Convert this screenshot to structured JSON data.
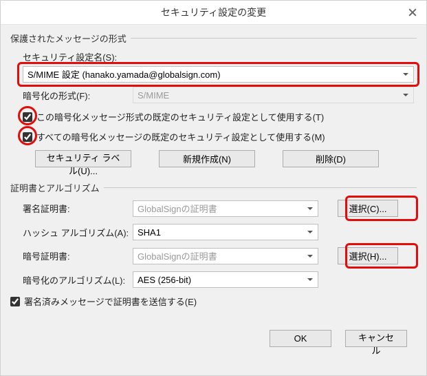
{
  "title": "セキュリティ設定の変更",
  "group1_title": "保護されたメッセージの形式",
  "security_name_label": "セキュリティ設定名(S):",
  "security_name_value": "S/MIME 設定 (hanako.yamada@globalsign.com)",
  "enc_format_label": "暗号化の形式(F):",
  "enc_format_value": "S/MIME",
  "chk_default_format": "この暗号化メッセージ形式の既定のセキュリティ設定として使用する(T)",
  "chk_default_all": "すべての暗号化メッセージの既定のセキュリティ設定として使用する(M)",
  "btn_labels": "セキュリティ ラベル(U)...",
  "btn_new": "新規作成(N)",
  "btn_delete": "削除(D)",
  "group2_title": "証明書とアルゴリズム",
  "sign_cert_label": "署名証明書:",
  "sign_cert_value": "GlobalSignの証明書",
  "btn_choose_c": "選択(C)...",
  "hash_label": "ハッシュ アルゴリズム(A):",
  "hash_value": "SHA1",
  "enc_cert_label": "暗号証明書:",
  "enc_cert_value": "GlobalSignの証明書",
  "btn_choose_h": "選択(H)...",
  "enc_algo_label": "暗号化のアルゴリズム(L):",
  "enc_algo_value": "AES (256-bit)",
  "chk_send_cert": "署名済みメッセージで証明書を送信する(E)",
  "btn_ok": "OK",
  "btn_cancel": "キャンセル"
}
